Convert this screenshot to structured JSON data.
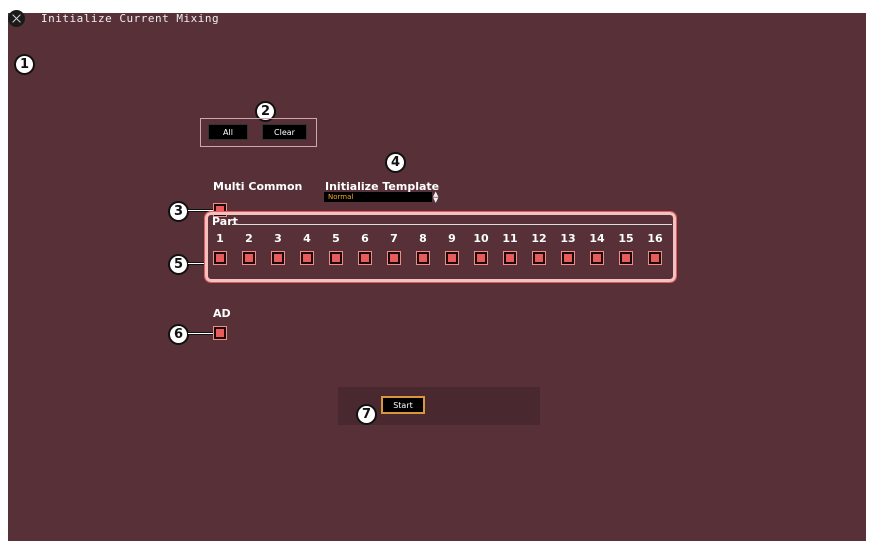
{
  "window": {
    "title": "Initialize Current Mixing"
  },
  "callouts": [
    "1",
    "2",
    "3",
    "4",
    "5",
    "6",
    "7"
  ],
  "selection_buttons": {
    "all": "All",
    "clear": "Clear"
  },
  "multi_common": {
    "label": "Multi Common",
    "checked": true
  },
  "initialize_template": {
    "label": "Initialize Template",
    "value": "Normal"
  },
  "parts": {
    "label": "Part",
    "items": [
      {
        "number": "1",
        "checked": true
      },
      {
        "number": "2",
        "checked": true
      },
      {
        "number": "3",
        "checked": true
      },
      {
        "number": "4",
        "checked": true
      },
      {
        "number": "5",
        "checked": true
      },
      {
        "number": "6",
        "checked": true
      },
      {
        "number": "7",
        "checked": true
      },
      {
        "number": "8",
        "checked": true
      },
      {
        "number": "9",
        "checked": true
      },
      {
        "number": "10",
        "checked": true
      },
      {
        "number": "11",
        "checked": true
      },
      {
        "number": "12",
        "checked": true
      },
      {
        "number": "13",
        "checked": true
      },
      {
        "number": "14",
        "checked": true
      },
      {
        "number": "15",
        "checked": true
      },
      {
        "number": "16",
        "checked": true
      }
    ]
  },
  "ad": {
    "label": "AD",
    "checked": true
  },
  "start_button": {
    "label": "Start"
  },
  "colors": {
    "background": "#573038",
    "checkbox": "#e75b5b",
    "accent": "#f5a623"
  }
}
